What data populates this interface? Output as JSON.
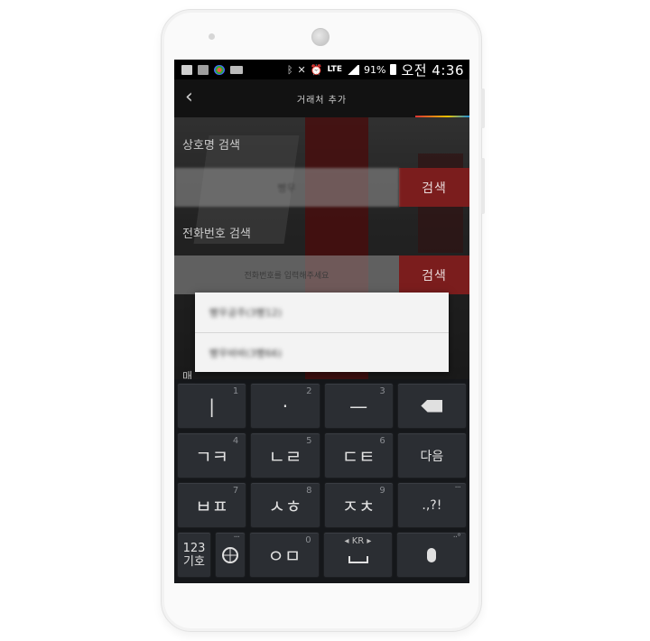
{
  "status_bar": {
    "lte": "LTE",
    "battery": "91%",
    "time": "오전 4:36"
  },
  "app_bar": {
    "back_glyph": "‹",
    "title": "거래처 추가"
  },
  "form": {
    "name_search_label": "상호명 검색",
    "name_search_value": "빵우",
    "name_search_button": "검색",
    "phone_search_label": "전화번호 검색",
    "phone_search_placeholder": "전화번호를 입력해주세요",
    "phone_search_button": "검색",
    "partial_label": "매"
  },
  "dropdown": {
    "items": [
      "빵우공주(3빵12)",
      "빵우바바(3빵66)"
    ]
  },
  "keyboard": {
    "row1": [
      {
        "label": "|",
        "sub": "1"
      },
      {
        "label": "·",
        "sub": "2"
      },
      {
        "label": "—",
        "sub": "3"
      },
      {
        "label": "",
        "sub": ""
      }
    ],
    "row2": [
      {
        "label": "ㄱㅋ",
        "sub": "4"
      },
      {
        "label": "ㄴㄹ",
        "sub": "5"
      },
      {
        "label": "ㄷㅌ",
        "sub": "6"
      },
      {
        "label": "다음",
        "sub": ""
      }
    ],
    "row3": [
      {
        "label": "ㅂㅍ",
        "sub": "7"
      },
      {
        "label": "ㅅㅎ",
        "sub": "8"
      },
      {
        "label": "ㅈㅊ",
        "sub": "9"
      },
      {
        "label": ".,?!",
        "sub": ""
      }
    ],
    "row4": {
      "symbols_top": "123",
      "symbols_bottom": "기호",
      "om_label": "ㅇㅁ",
      "om_sub": "0",
      "lang": "KR"
    }
  },
  "colors": {
    "search_button": "#7b1d1d",
    "keyboard_bg": "#15171a",
    "key_bg": "#2b2e33"
  }
}
